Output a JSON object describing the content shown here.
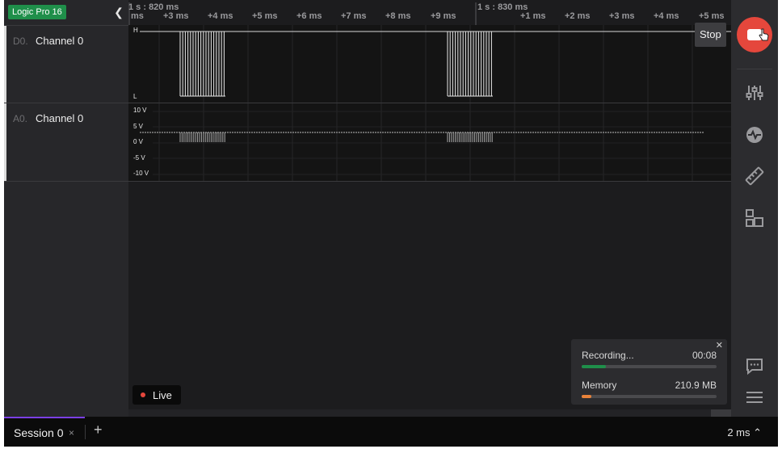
{
  "device": {
    "name": "Logic Pro 16"
  },
  "channels": [
    {
      "id": "D0.",
      "name": "Channel 0"
    },
    {
      "id": "A0.",
      "name": "Channel 0"
    }
  ],
  "ruler": {
    "major": [
      {
        "label": "1 s : 820 ms"
      },
      {
        "label": "1 s : 830 ms"
      }
    ],
    "ticks": [
      "ms",
      "+3 ms",
      "+4 ms",
      "+5 ms",
      "+6 ms",
      "+7 ms",
      "+8 ms",
      "+9 ms",
      "+1 ms",
      "+2 ms",
      "+3 ms",
      "+4 ms",
      "+5 ms"
    ]
  },
  "digital_levels": {
    "high": "H",
    "low": "L"
  },
  "analog_levels": [
    "10 V",
    "5 V",
    "0 V",
    "-5 V",
    "-10 V"
  ],
  "toolbar": {
    "stop_tooltip": "Stop",
    "icons": [
      "stop-icon",
      "sliders-icon",
      "waveform-analyzer-icon",
      "ruler-measure-icon",
      "extensions-icon",
      "chat-feedback-icon",
      "menu-icon"
    ]
  },
  "recording": {
    "label": "Recording...",
    "time": "00:08",
    "progress": 0.18,
    "memory_label": "Memory",
    "memory_value": "210.9 MB",
    "memory_fraction": 0.07,
    "progress_color": "#1f8f4a",
    "memory_color": "#e8823a"
  },
  "live": {
    "label": "Live"
  },
  "tabs": {
    "session_label": "Session 0",
    "close": "×",
    "add": "+"
  },
  "zoom": {
    "label": "2 ms ⌃"
  },
  "colors": {
    "accent": "#e5473c",
    "device_badge": "#1f8f4a",
    "tab_underline": "#7b3fe4"
  }
}
